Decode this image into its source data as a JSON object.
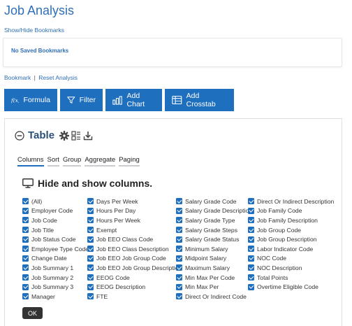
{
  "page": {
    "title": "Job Analysis"
  },
  "bookmarks": {
    "toggle_label": "Show/Hide Bookmarks",
    "empty_message": "No Saved Bookmarks",
    "bookmark_label": "Bookmark",
    "separator": "|",
    "reset_label": "Reset Analysis"
  },
  "toolbar": {
    "buttons": [
      {
        "label": "Formula",
        "icon": "function-icon"
      },
      {
        "label": "Filter",
        "icon": "funnel-icon"
      },
      {
        "label": "Add Chart",
        "icon": "bar-chart-icon"
      },
      {
        "label": "Add Crosstab",
        "icon": "crosstab-icon"
      }
    ]
  },
  "table": {
    "title": "Table",
    "header_icons": [
      "collapse-icon",
      "gear-icon",
      "column-settings-icon",
      "download-icon"
    ],
    "tabs": [
      "Columns",
      "Sort",
      "Group",
      "Aggregate",
      "Paging"
    ],
    "active_tab": "Columns",
    "columns_section_title": "Hide and show columns.",
    "column_groups": [
      [
        "(All)",
        "Employer Code",
        "Job Code",
        "Job Title",
        "Job Status Code",
        "Employee Type Code",
        "Change Date",
        "Job Summary 1",
        "Job Summary 2",
        "Job Summary 3",
        "Manager"
      ],
      [
        "Days Per Week",
        "Hours Per Day",
        "Hours Per Week",
        "Exempt",
        "Job EEO Class Code",
        "Job EEO Class Description",
        "Job EEO Job Group Code",
        "Job EEO Job Group Description",
        "EEOG Code",
        "EEOG Description",
        "FTE"
      ],
      [
        "Salary Grade Code",
        "Salary Grade Description",
        "Salary Grade Type",
        "Salary Grade Steps",
        "Salary Grade Status",
        "Minimum Salary",
        "Midpoint Salary",
        "Maximum Salary",
        "Min Max Per Code",
        "Min Max Per",
        "Direct Or Indirect Code"
      ],
      [
        "Direct Or Indirect Description",
        "Job Family Code",
        "Job Family Description",
        "Job Group Code",
        "Job Group Description",
        "Labor Indicator Code",
        "NOC Code",
        "NOC Description",
        "Total Points",
        "Overtime Eligible Code"
      ]
    ],
    "ok_label": "OK",
    "accent_color": "#1f6fbf"
  }
}
